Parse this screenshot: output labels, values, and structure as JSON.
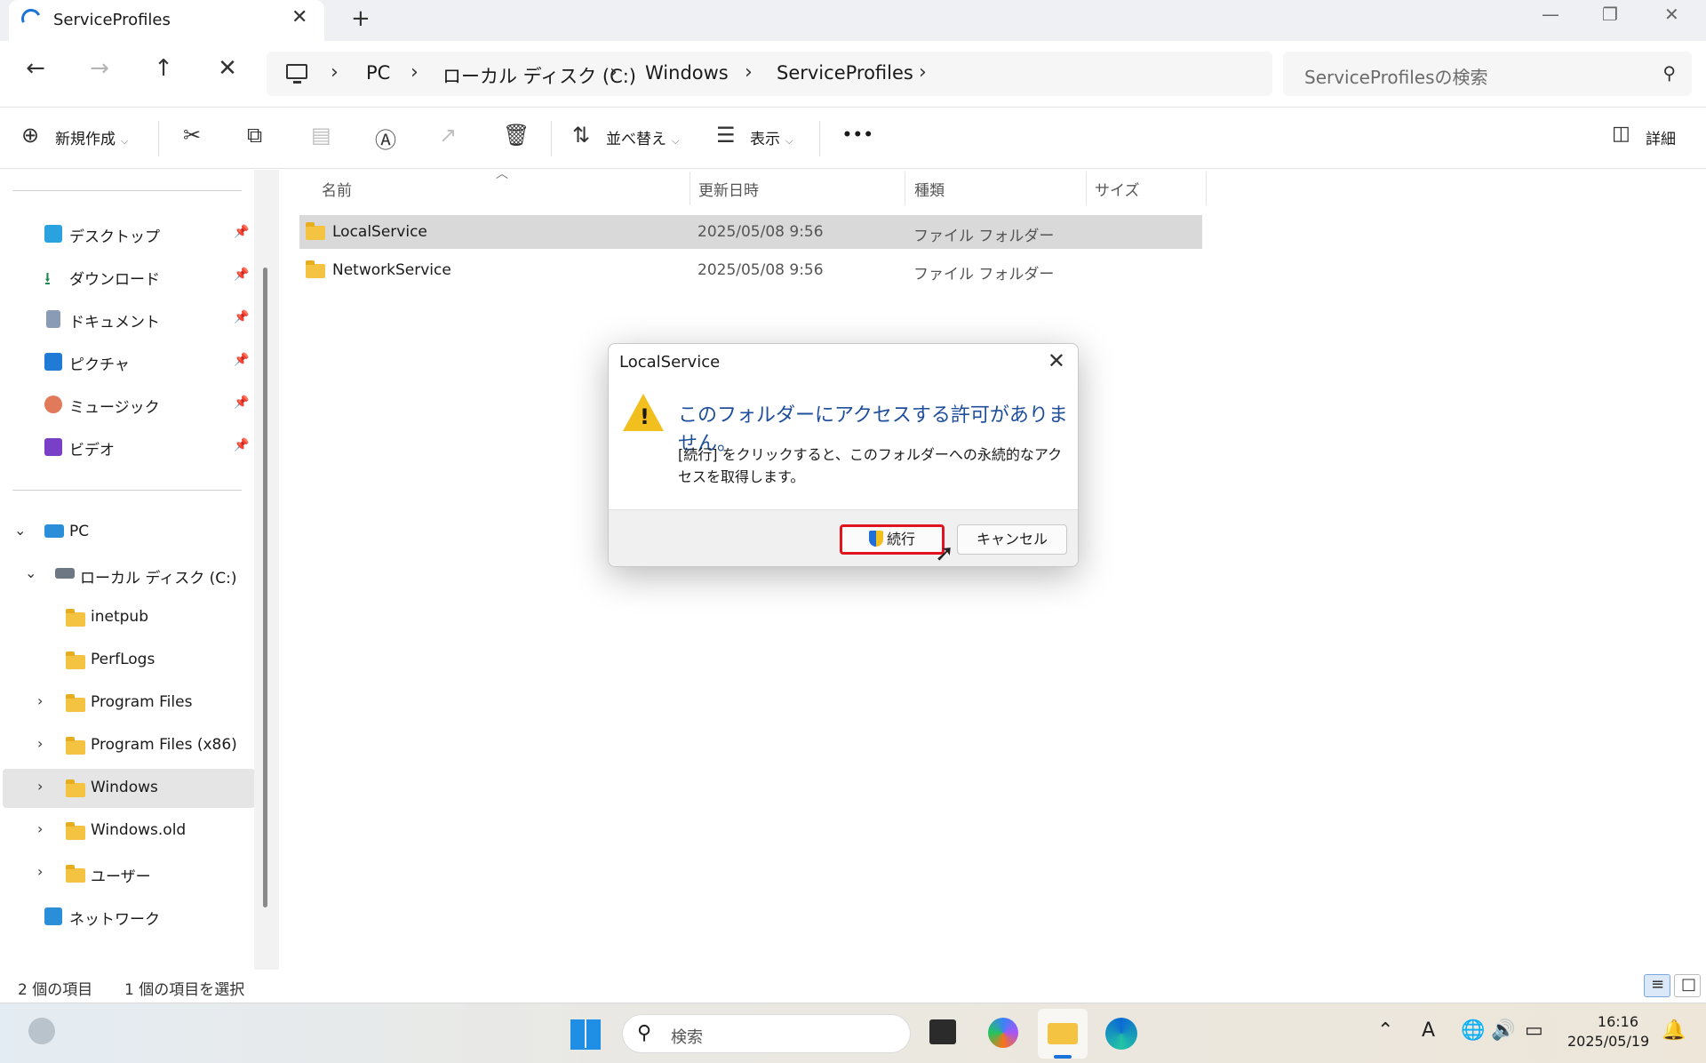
{
  "window": {
    "tab_title": "ServiceProfiles",
    "tab_close": "✕",
    "new_tab": "+"
  },
  "address": {
    "crumbs": [
      "PC",
      "ローカル ディスク (C:)",
      "Windows",
      "ServiceProfiles"
    ],
    "search_placeholder": "ServiceProfilesの検索"
  },
  "toolbar": {
    "new_label": "新規作成",
    "sort_label": "並べ替え",
    "view_label": "表示",
    "more_label": "•••",
    "details_label": "詳細"
  },
  "sidebar": {
    "quick_access": [
      "デスクトップ",
      "ダウンロード",
      "ドキュメント",
      "ピクチャ",
      "ミュージック",
      "ビデオ"
    ],
    "pc_label": "PC",
    "drive_label": "ローカル ディスク (C:)",
    "folders": [
      "inetpub",
      "PerfLogs",
      "Program Files",
      "Program Files (x86)",
      "Windows",
      "Windows.old",
      "ユーザー"
    ],
    "network_label": "ネットワーク"
  },
  "file_list": {
    "columns": [
      "名前",
      "更新日時",
      "種類",
      "サイズ"
    ],
    "rows": [
      {
        "name": "LocalService",
        "modified": "2025/05/08 9:56",
        "type": "ファイル フォルダー",
        "size": ""
      },
      {
        "name": "NetworkService",
        "modified": "2025/05/08 9:56",
        "type": "ファイル フォルダー",
        "size": ""
      }
    ]
  },
  "status": {
    "item_count": "2 個の項目",
    "selected_count": "1 個の項目を選択"
  },
  "dialog": {
    "title": "LocalService",
    "heading": "このフォルダーにアクセスする許可がありません。",
    "body": "[続行] をクリックすると、このフォルダーへの永続的なアクセスを取得します。",
    "continue_label": "続行",
    "cancel_label": "キャンセル"
  },
  "taskbar": {
    "search_placeholder": "検索",
    "time": "16:16",
    "date": "2025/05/19",
    "ime_label": "A"
  },
  "colors": {
    "accent": "#1a73d9",
    "highlight_border": "#e0141f",
    "dialog_heading": "#1f4e9a",
    "warning": "#f2c01e",
    "folder": "#f5c342"
  }
}
